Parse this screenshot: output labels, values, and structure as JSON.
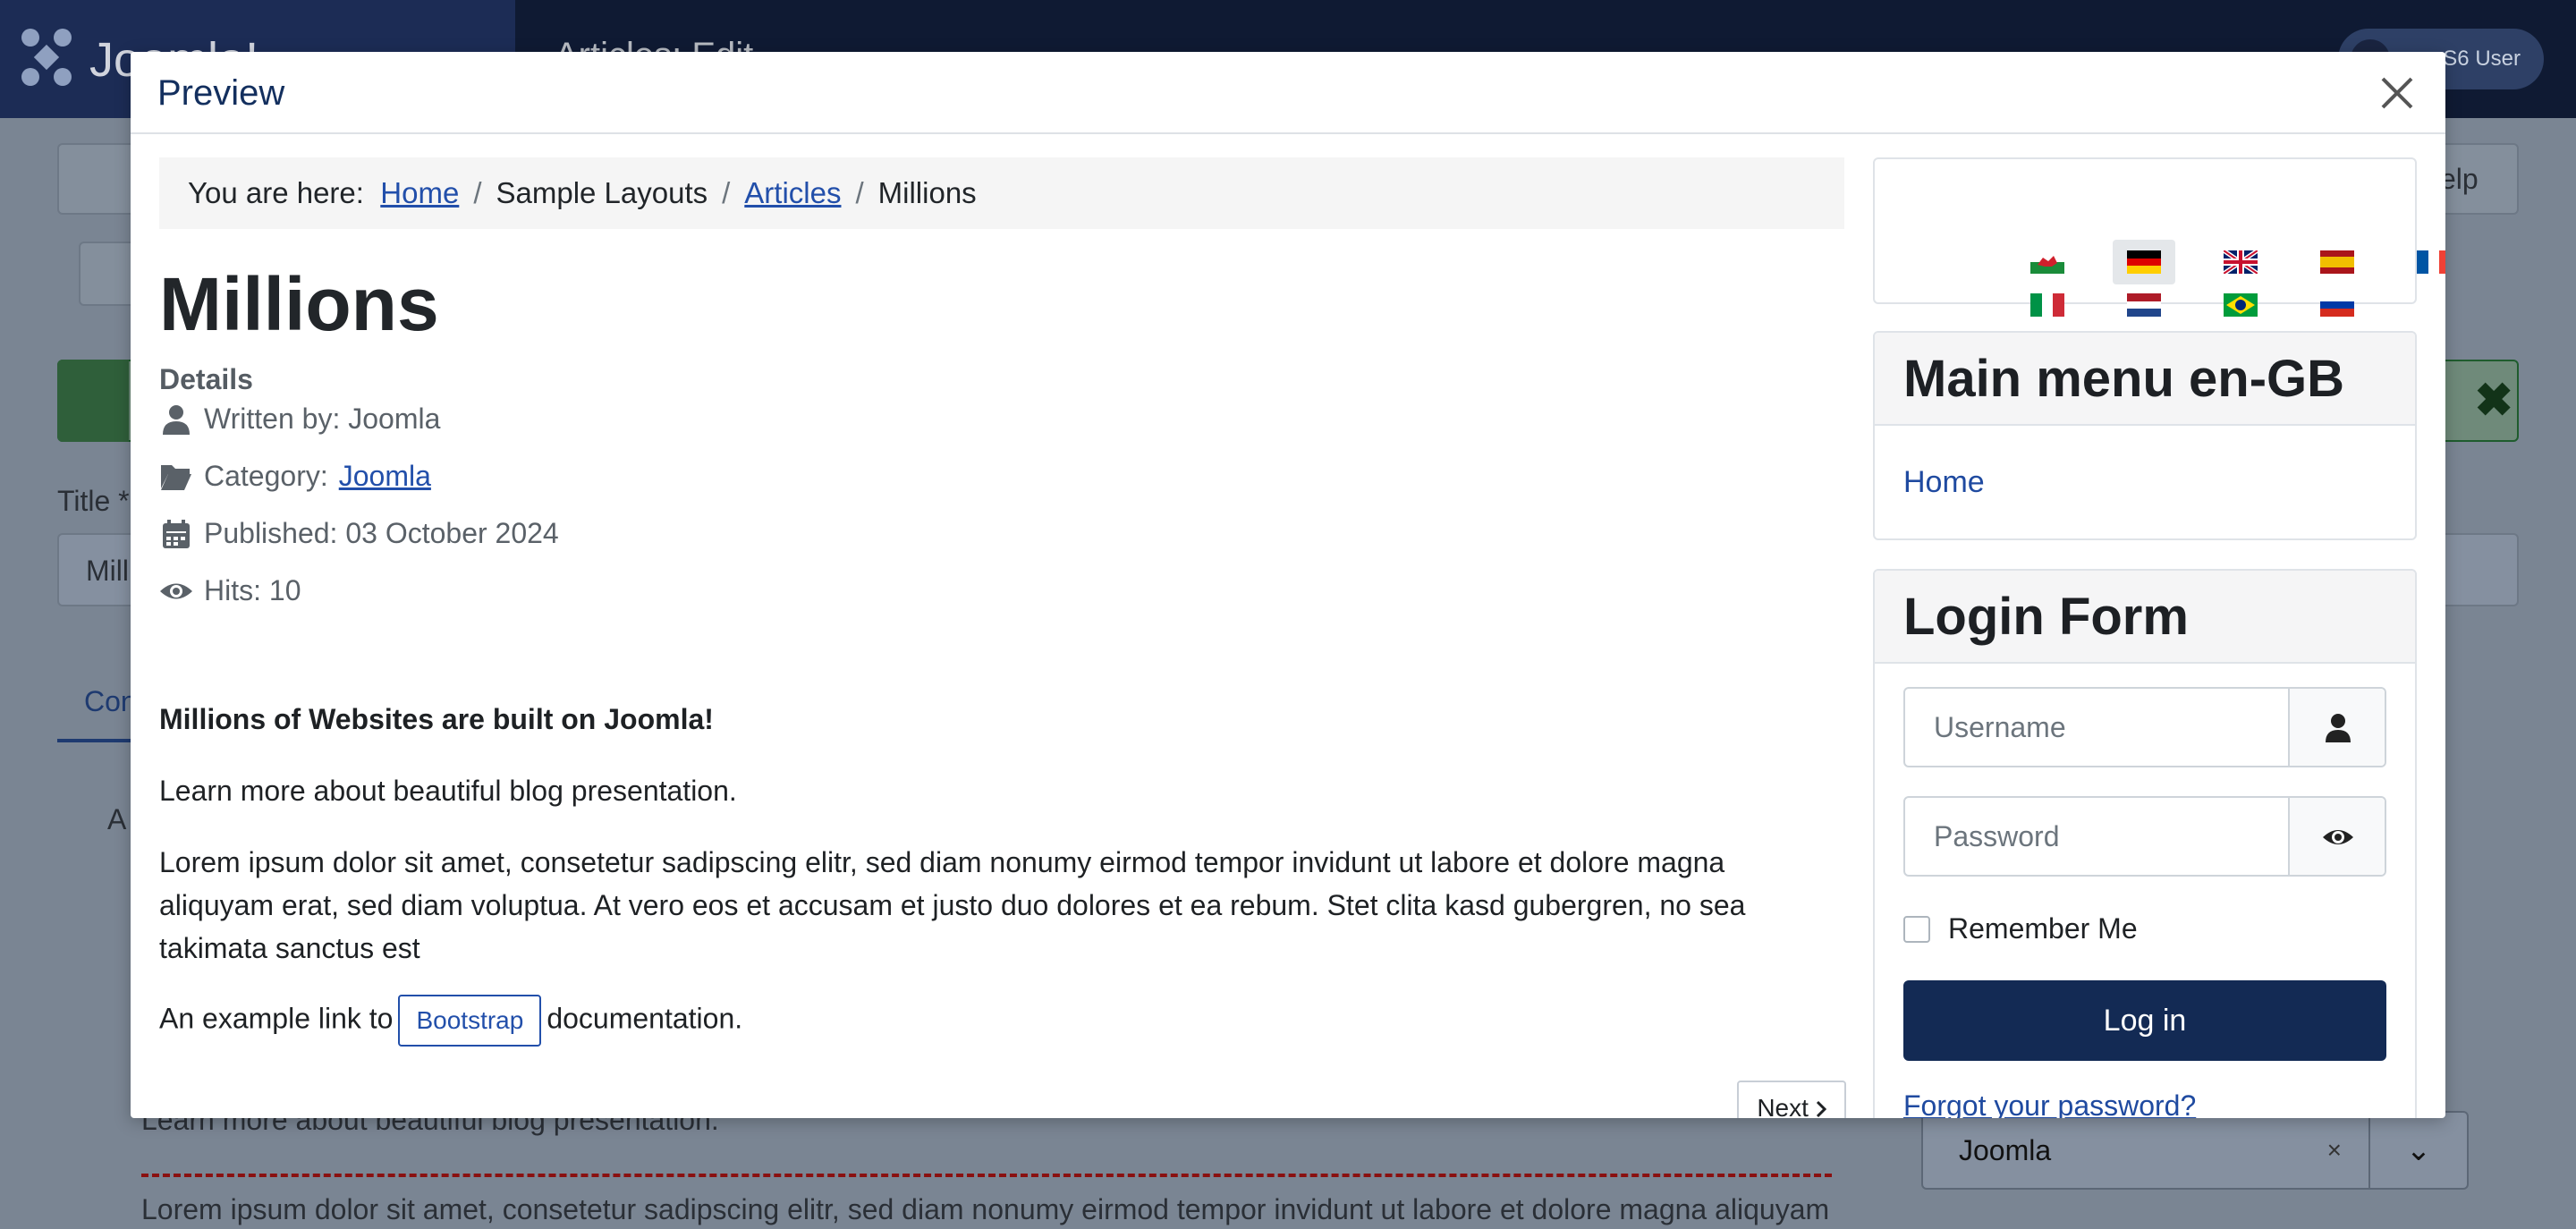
{
  "background": {
    "logo_text": "Joomla!",
    "header_title": "Articles: Edit",
    "user_label": "S6 User",
    "select_value": "Joomla",
    "title_label": "Title *",
    "title_value": "Mill",
    "tab_partial": "Con",
    "field_partial": "A",
    "bottom_text_1": "Learn more about beautiful blog presentation.",
    "bottom_text_2": "Lorem ipsum dolor sit amet, consetetur sadipscing elitr, sed diam nonumy eirmod tempor invidunt ut labore et dolore magna aliquyam",
    "help_partial": "elp"
  },
  "modal": {
    "title": "Preview",
    "close_icon": "close-icon"
  },
  "breadcrumb": {
    "prefix": "You are here:",
    "items": [
      "Home",
      "Sample Layouts",
      "Articles",
      "Millions"
    ]
  },
  "article": {
    "title": "Millions",
    "details_label": "Details",
    "written_by": "Written by: Joomla",
    "category_label": "Category:",
    "category_value": "Joomla",
    "published": "Published: 03 October 2024",
    "hits": "Hits: 10",
    "intro_bold": "Millions of Websites are built on Joomla!",
    "para_1": "Learn more about beautiful blog presentation.",
    "para_2": "Lorem ipsum dolor sit amet, consetetur sadipscing elitr, sed diam nonumy eirmod tempor invidunt ut labore et dolore magna aliquyam erat, sed diam voluptua. At vero eos et accusam et justo duo dolores et ea rebum. Stet clita kasd gubergren, no sea takimata sanctus est",
    "link_prefix": "An example link to",
    "link_label": "Bootstrap",
    "link_suffix": "documentation.",
    "next_label": "Next"
  },
  "languages": [
    "cy-GB",
    "de-DE",
    "en-GB",
    "es-ES",
    "fr-FR",
    "it-IT",
    "nl-NL",
    "pt-BR",
    "ru-RU"
  ],
  "main_menu": {
    "title": "Main menu en-GB",
    "items": [
      "Home"
    ]
  },
  "login": {
    "title": "Login Form",
    "username_placeholder": "Username",
    "password_placeholder": "Password",
    "remember_label": "Remember Me",
    "login_label": "Log in",
    "forgot_label": "Forgot your password?"
  }
}
